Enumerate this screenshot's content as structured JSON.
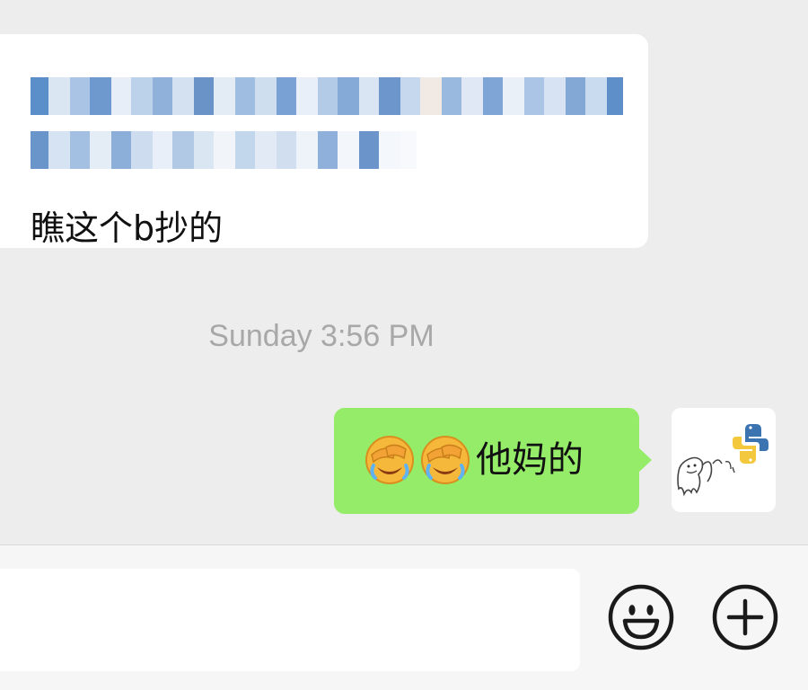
{
  "conversation": {
    "incoming_message": {
      "text": "瞧这个b抄的",
      "blurred_link_present": true
    },
    "timestamp": "Sunday 3:56 PM",
    "outgoing_message": {
      "emoji": [
        "face-palm-crying-emoji",
        "face-palm-crying-emoji"
      ],
      "text": "他妈的"
    },
    "sender_avatar_icon": "python-doodle-avatar"
  },
  "composer": {
    "input_value": "",
    "emoji_button_icon": "smiley-icon",
    "more_button_icon": "plus-circle-icon"
  },
  "colors": {
    "background": "#ededed",
    "incoming_bubble": "#ffffff",
    "outgoing_bubble": "#95ec69",
    "timestamp_text": "#a8a8a8",
    "icon_stroke": "#1a1a1a"
  }
}
